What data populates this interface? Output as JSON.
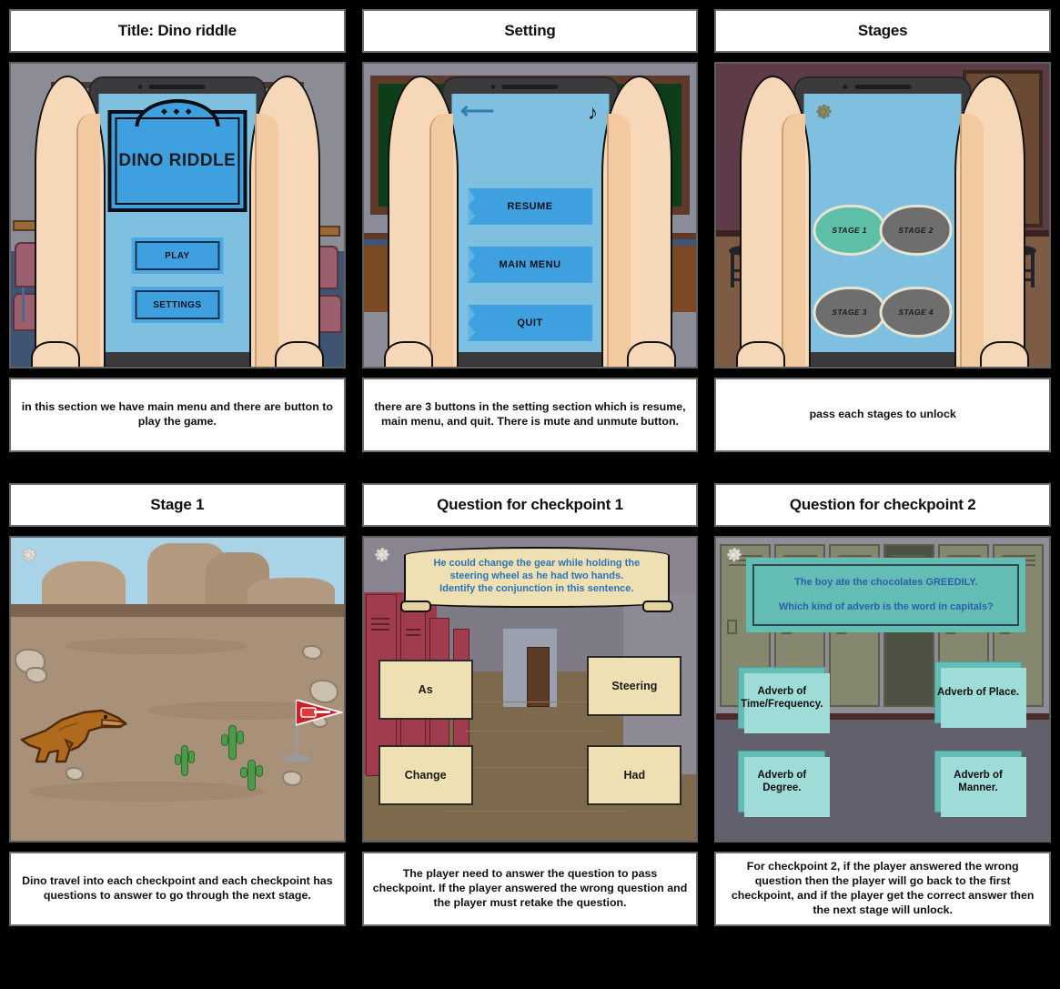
{
  "board": {
    "background_color": "#000000",
    "panel_border_color": "#6d6d6d"
  },
  "panels": [
    {
      "id": "panel-1",
      "title": "Title: Dino riddle",
      "caption": "in this section we have main menu and there are button to play the game.",
      "scene": "phone-main-menu",
      "screen": {
        "plate_text": "DINO RIDDLE",
        "buttons": [
          {
            "label": "PLAY"
          },
          {
            "label": "SETTINGS"
          }
        ]
      }
    },
    {
      "id": "panel-2",
      "title": "Setting",
      "caption": "there are 3 buttons in the setting section which is resume, main menu, and quit. There is mute and unmute button.",
      "scene": "phone-settings",
      "screen": {
        "back_icon": "back-arrow-icon",
        "music_icon": "music-note-icon",
        "buttons": [
          {
            "label": "RESUME"
          },
          {
            "label": "MAIN MENU"
          },
          {
            "label": "QUIT"
          }
        ]
      }
    },
    {
      "id": "panel-3",
      "title": "Stages",
      "caption": "pass each stages to unlock",
      "scene": "phone-stage-select",
      "screen": {
        "gear_icon": "gear-icon",
        "stages": [
          {
            "label": "STAGE 1",
            "state": "unlocked",
            "color": "#5dbfa7"
          },
          {
            "label": "STAGE 2",
            "state": "locked",
            "color": "#6e6e6e"
          },
          {
            "label": "STAGE 3",
            "state": "locked",
            "color": "#6e6e6e"
          },
          {
            "label": "STAGE 4",
            "state": "locked",
            "color": "#6e6e6e"
          }
        ]
      }
    },
    {
      "id": "panel-4",
      "title": "Stage 1",
      "caption": "Dino travel into each checkpoint and each checkpoint has questions to answer to go through the next stage.",
      "scene": "desert-gameplay",
      "screen": {
        "gear_icon": "gear-icon",
        "character": "t-rex",
        "goal": "red-flag"
      }
    },
    {
      "id": "panel-5",
      "title": "Question for checkpoint 1",
      "caption": "The player need to answer the question to pass checkpoint. If the player answered the wrong question and the player must retake the question.",
      "scene": "hallway-question",
      "screen": {
        "gear_icon": "gear-icon",
        "question_lines": [
          "He could change the gear while holding the",
          "steering wheel as he had two hands.",
          "Identify the conjunction in this sentence."
        ],
        "answers": [
          {
            "label": "As"
          },
          {
            "label": "Steering"
          },
          {
            "label": "Change"
          },
          {
            "label": "Had"
          }
        ]
      }
    },
    {
      "id": "panel-6",
      "title": "Question for checkpoint 2",
      "caption": "For checkpoint 2, if the player answered the wrong question then the player will go back to the first checkpoint, and if the player get the correct answer then the next stage will unlock.",
      "scene": "locker-question",
      "screen": {
        "gear_icon": "gear-icon",
        "question_lines": [
          "The boy ate the chocolates GREEDILY.",
          "Which kind of adverb is the word in capitals?"
        ],
        "answers": [
          {
            "label": "Adverb of Time/Frequency."
          },
          {
            "label": "Adverb of Place."
          },
          {
            "label": "Adverb of Degree."
          },
          {
            "label": "Adverb of Manner."
          }
        ]
      }
    }
  ]
}
